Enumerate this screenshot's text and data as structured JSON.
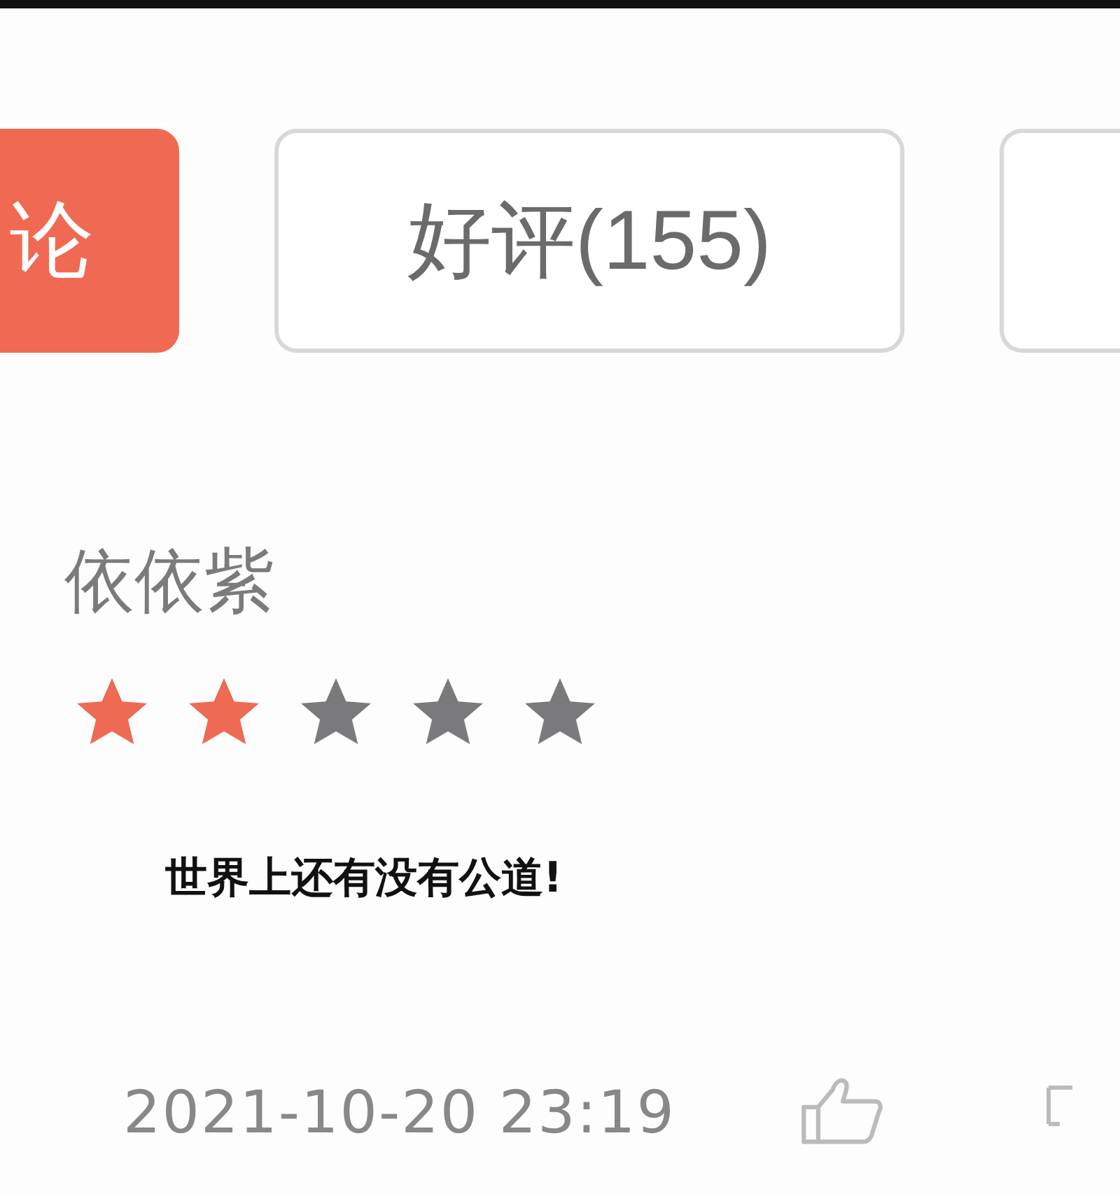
{
  "tabs": [
    {
      "label": "论",
      "selected": true
    },
    {
      "label": "好评(155)",
      "selected": false
    },
    {
      "selected": false
    }
  ],
  "review": {
    "user": "依依紫",
    "stars": 2,
    "text": "世界上还有没有公道!",
    "time": "2021-10-20 23:19"
  }
}
